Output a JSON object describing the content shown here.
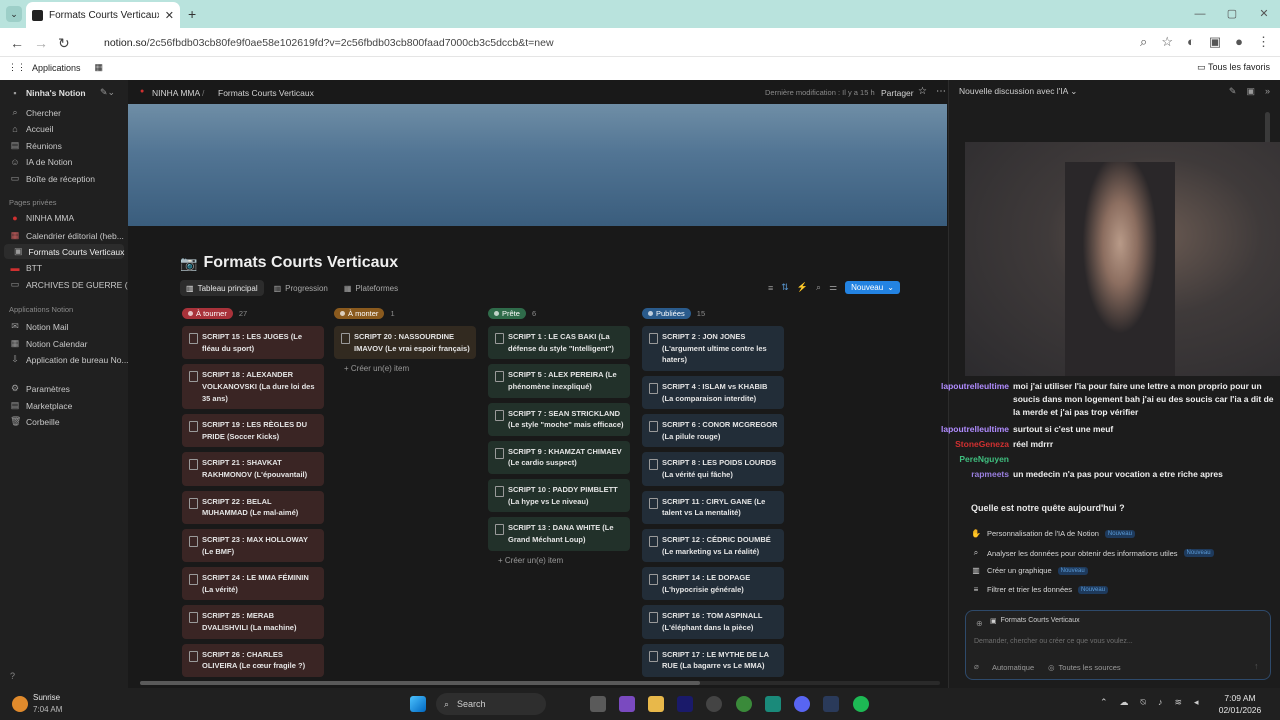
{
  "browser": {
    "tab_title": "Formats Courts Verticaux | Tabl",
    "url_host": "notion.so",
    "url_path": "/2c56fbdb03cb80fe9f0ae58e102619fd?v=2c56fbdb03cb800faad7000cb3c5dccb&t=new",
    "bookmarks_apps": "Applications",
    "bookmarks_all": "Tous les favoris"
  },
  "sidebar": {
    "workspace": "Ninha's Notion",
    "nav": [
      "Chercher",
      "Accueil",
      "Réunions",
      "IA de Notion",
      "Boîte de réception"
    ],
    "private_header": "Pages privées",
    "private": [
      "NINHA MMA",
      "Calendrier éditorial (heb...",
      "Formats Courts Verticaux",
      "BTT",
      "ARCHIVES DE GUERRE (Hi..."
    ],
    "apps_header": "Applications Notion",
    "apps": [
      "Notion Mail",
      "Notion Calendar",
      "Application de bureau No..."
    ],
    "bottom": [
      "Paramètres",
      "Marketplace",
      "Corbeille"
    ]
  },
  "topbar": {
    "crumb1": "NINHA MMA",
    "crumb2": "Formats Courts Verticaux",
    "modified": "Dernière modification : Il y a 15 h",
    "share": "Partager"
  },
  "page": {
    "title": "Formats Courts Verticaux",
    "views": [
      "Tableau principal",
      "Progression",
      "Plateformes"
    ],
    "new_button": "Nouveau",
    "add_item": "Créer un(e) item"
  },
  "board": [
    {
      "status": "À tourner",
      "count": "27",
      "color": "#a8323a",
      "card_bg": "#3a2524",
      "cards": [
        "SCRIPT 15 : LES JUGES (Le fléau du sport)",
        "SCRIPT 18 : ALEXANDER VOLKANOVSKI (La dure loi des 35 ans)",
        "SCRIPT 19 : LES RÈGLES DU PRIDE (Soccer Kicks)",
        "SCRIPT 21 : SHAVKAT RAKHMONOV (L'épouvantail)",
        "SCRIPT 22 : BELAL MUHAMMAD (Le mal-aimé)",
        "SCRIPT 23 : MAX HOLLOWAY (Le BMF)",
        "SCRIPT 24 : LE MMA FÉMININ (La vérité)",
        "SCRIPT 25 : MERAB DVALISHVILI (La machine)",
        "SCRIPT 26 : CHARLES OLIVEIRA (Le cœur fragile ?)"
      ]
    },
    {
      "status": "À monter",
      "count": "1",
      "color": "#8a5a1e",
      "card_bg": "#322a20",
      "cards": [
        "SCRIPT 20 : NASSOURDINE IMAVOV (Le vrai espoir français)"
      ]
    },
    {
      "status": "Prête",
      "count": "6",
      "color": "#2f6b4a",
      "card_bg": "#22312a",
      "cards": [
        "SCRIPT 1 : LE CAS BAKI (La défense du style \"Intelligent\")",
        "SCRIPT 5 : ALEX PEREIRA (Le phénomène inexpliqué)",
        "SCRIPT 7 : SEAN STRICKLAND (Le style \"moche\" mais efficace)",
        "SCRIPT 9 : KHAMZAT CHIMAEV (Le cardio suspect)",
        "SCRIPT 10 : PADDY PIMBLETT (La hype vs Le niveau)",
        "SCRIPT 13 : DANA WHITE (Le Grand Méchant Loup)"
      ]
    },
    {
      "status": "Publiées",
      "count": "15",
      "color": "#2a5b8c",
      "card_bg": "#222d38",
      "cards": [
        "SCRIPT 2 : JON JONES (L'argument ultime contre les haters)",
        "SCRIPT 4 : ISLAM vs KHABIB (La comparaison interdite)",
        "SCRIPT 6 : CONOR MCGREGOR (La pilule rouge)",
        "SCRIPT 8 : LES POIDS LOURDS (La vérité qui fâche)",
        "SCRIPT 11 : CIRYL GANE (Le talent vs La mentalité)",
        "SCRIPT 12 : CÉDRIC DOUMBÉ (Le marketing vs La réalité)",
        "SCRIPT 14 : LE DOPAGE (L'hypocrisie générale)",
        "SCRIPT 16 : TOM ASPINALL (L'éléphant dans la pièce)",
        "SCRIPT 17 : LE MYTHE DE LA RUE (La bagarre vs Le MMA)"
      ]
    }
  ],
  "ai_panel": {
    "header": "Nouvelle discussion avec l'IA",
    "question": "Quelle est notre quête aujourd'hui ?",
    "suggestions": [
      {
        "label": "Personnalisation de l'IA de Notion",
        "badge": "Nouveau"
      },
      {
        "label": "Analyser les données pour obtenir des informations utiles",
        "badge": "Nouveau"
      },
      {
        "label": "Créer un graphique",
        "badge": "Nouveau"
      },
      {
        "label": "Filtrer et trier les données",
        "badge": "Nouveau"
      }
    ],
    "context_chip": "Formats Courts Verticaux",
    "input_placeholder": "Demander, chercher ou créer ce que vous voulez...",
    "mode": "Automatique",
    "sources": "Toutes les sources"
  },
  "chat": [
    {
      "user": "lapoutrelleultime",
      "color": "#b08cff",
      "text": "moi j'ai utiliser l'ia pour faire une lettre a mon proprio pour un soucis dans mon logement bah j'ai eu des soucis car l'ia a dit de la merde et j'ai pas trop vérifier"
    },
    {
      "user": "lapoutrelleultime",
      "color": "#b08cff",
      "text": "surtout si c'est une meuf"
    },
    {
      "user": "StoneGeneza",
      "color": "#d03030",
      "text": "réel mdrrr"
    },
    {
      "user": "PereNguyen",
      "color": "#3fbf7f",
      "text": ""
    },
    {
      "user": "rapmeets",
      "color": "#9a7fe0",
      "text": "un medecin n'a pas pour vocation a etre riche apres"
    }
  ],
  "taskbar": {
    "weather": "Sunrise",
    "weather_time": "7:04 AM",
    "search": "Search",
    "time": "7:09 AM",
    "date": "02/01/2026"
  }
}
